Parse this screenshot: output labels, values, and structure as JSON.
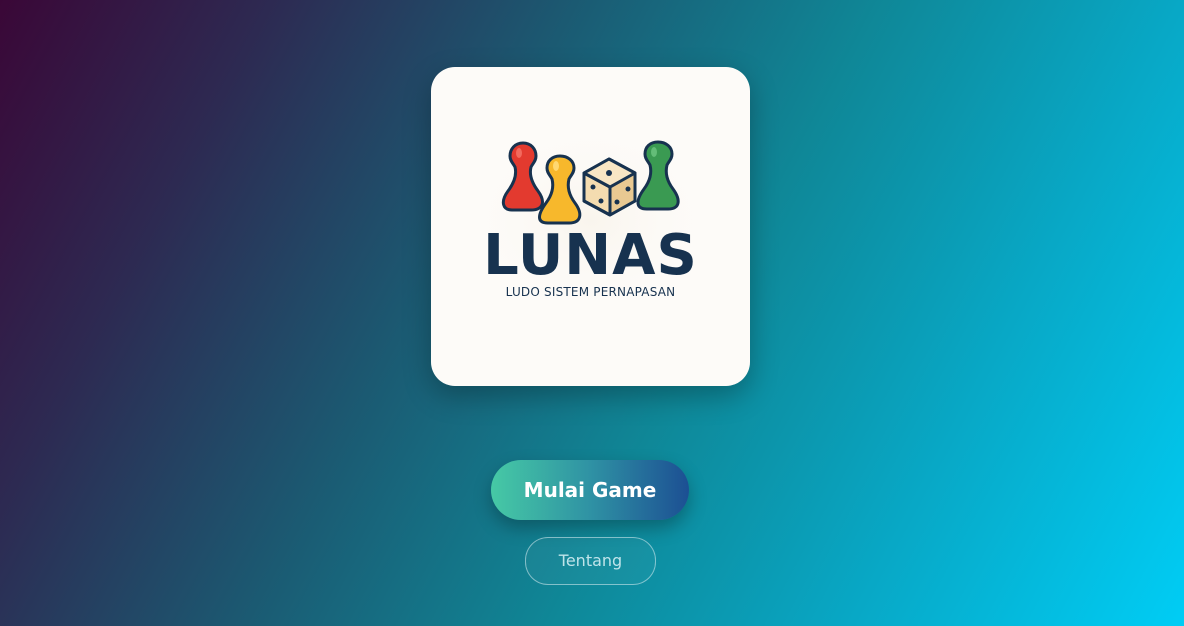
{
  "logo": {
    "title": "LUNAS",
    "subtitle": "LUDO SISTEM PERNAPASAN",
    "icons": [
      "red-pawn-icon",
      "yellow-pawn-icon",
      "dice-icon",
      "green-pawn-icon"
    ],
    "colors": {
      "card_background": "#fdfbf8",
      "text": "#17324f",
      "red_pawn": "#e33a2f",
      "yellow_pawn": "#f7b82c",
      "green_pawn": "#3a9a52",
      "dice": "#f4dcb0"
    }
  },
  "menu": {
    "start_label": "Mulai Game",
    "about_label": "Tentang"
  },
  "colors": {
    "background_start": "#3a0737",
    "background_end": "#00cdf5",
    "start_button_start": "#46c9a5",
    "start_button_end": "#1c4f93"
  }
}
